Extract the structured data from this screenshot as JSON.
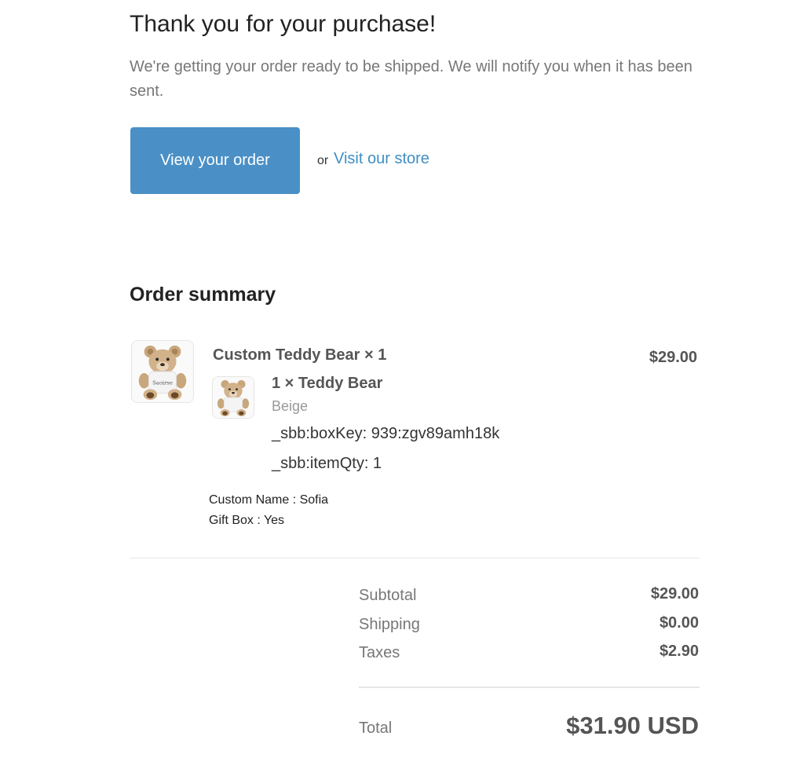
{
  "heading": "Thank you for your purchase!",
  "subtext": "We're getting your order ready to be shipped. We will notify you when it has been sent.",
  "actions": {
    "view_order_label": "View your order",
    "or_text": "or",
    "store_link_label": "Visit our store"
  },
  "summary": {
    "title": "Order summary",
    "item": {
      "name": "Custom Teddy Bear × 1",
      "price": "$29.00",
      "image_icon": "teddy-bear-image",
      "bear_shirt_text": "Saoirse",
      "bundle": {
        "name": "1 × Teddy Bear",
        "variant": "Beige",
        "props": [
          "_sbb:boxKey: 939:zgv89amh18k",
          "_sbb:itemQty: 1"
        ]
      },
      "custom_props": [
        "Custom Name : Sofia",
        "Gift Box : Yes"
      ]
    }
  },
  "totals": {
    "subtotal_label": "Subtotal",
    "subtotal_value": "$29.00",
    "shipping_label": "Shipping",
    "shipping_value": "$0.00",
    "taxes_label": "Taxes",
    "taxes_value": "$2.90",
    "total_label": "Total",
    "total_value": "$31.90 USD"
  },
  "colors": {
    "accent": "#4a90c6",
    "link": "#3f8fc3",
    "muted_text": "#777777"
  }
}
